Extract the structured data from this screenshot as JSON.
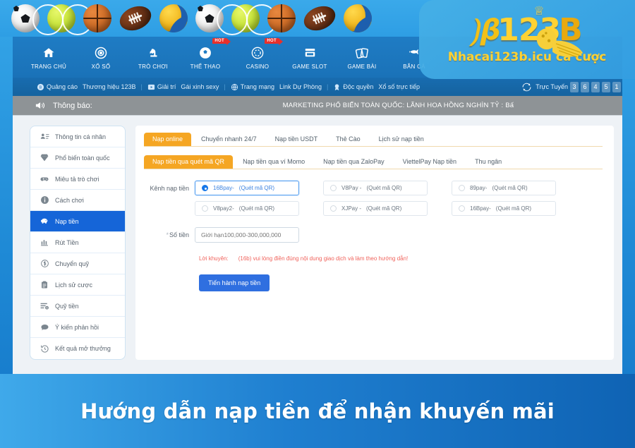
{
  "balls": [
    {
      "kind": "soccer",
      "icon": "soccer-ball-icon"
    },
    {
      "kind": "tennis",
      "icon": "tennis-ball-icon"
    },
    {
      "kind": "basket",
      "icon": "basketball-icon"
    },
    {
      "kind": "football",
      "icon": "american-football-icon"
    },
    {
      "kind": "volley",
      "icon": "volleyball-icon"
    },
    {
      "kind": "soccer",
      "icon": "soccer-ball-icon"
    },
    {
      "kind": "tennis",
      "icon": "tennis-ball-icon"
    },
    {
      "kind": "basket",
      "icon": "basketball-icon"
    },
    {
      "kind": "football",
      "icon": "american-football-icon"
    },
    {
      "kind": "volley",
      "icon": "volleyball-icon"
    }
  ],
  "logo": {
    "brand_mark": "123",
    "brand_mark_b": "B",
    "brand_sub": "Nhacai123b.icu cá cược",
    "color_gold": "#ffd233"
  },
  "mainnav": {
    "items": [
      {
        "label": "TRANG CHỦ",
        "icon": "home-icon",
        "hot": ""
      },
      {
        "label": "XỔ SỐ",
        "icon": "lottery-ball-icon",
        "hot": ""
      },
      {
        "label": "TRÒ CHƠI",
        "icon": "chess-knight-icon",
        "hot": ""
      },
      {
        "label": "THỂ THAO",
        "icon": "soccer-ball-icon",
        "hot": "HOT"
      },
      {
        "label": "CASINO",
        "icon": "casino-chip-icon",
        "hot": "HOT"
      },
      {
        "label": "GAME SLOT",
        "icon": "slot-machine-icon",
        "hot": ""
      },
      {
        "label": "GAME BÀI",
        "icon": "playing-cards-icon",
        "hot": ""
      },
      {
        "label": "BẮN CÁ",
        "icon": "fish-icon",
        "hot": ""
      }
    ]
  },
  "subnav": {
    "quang_cao": "Quảng cáo",
    "thuong_hieu": "Thương hiệu 123B",
    "giai_tri": "Giải trí",
    "gai_xinh": "Gái xinh sexy",
    "trang_mang": "Trang mạng",
    "link_du_phong": "Link Dự Phòng",
    "doc_quyen": "Độc quyền",
    "xo_so_truc_tiep": "Xổ số trực tiếp",
    "truc_tuyen": "Trực Tuyến",
    "online_digits": [
      "3",
      "6",
      "4",
      "5",
      "1"
    ],
    "sep": "|"
  },
  "announce": {
    "title": "Thông báo:",
    "marquee": "MARKETING PHỔ BIẾN TOÀN QUỐC:     LÃNH HOA HỒNG NGHÌN TỶ : Bấ"
  },
  "sidebar": {
    "items": [
      {
        "label": "Thông tin cá nhân",
        "icon": "user-card-icon",
        "active": false
      },
      {
        "label": "Phổ biến toàn quốc",
        "icon": "diamond-icon",
        "active": false
      },
      {
        "label": "Miêu tả trò chơi",
        "icon": "gamepad-icon",
        "active": false
      },
      {
        "label": "Cách chơi",
        "icon": "info-icon",
        "active": false
      },
      {
        "label": "Nạp tiền",
        "icon": "piggy-bank-icon",
        "active": true
      },
      {
        "label": "Rút Tiền",
        "icon": "withdraw-icon",
        "active": false
      },
      {
        "label": "Chuyển quỹ",
        "icon": "dollar-circle-icon",
        "active": false
      },
      {
        "label": "Lịch sử cược",
        "icon": "clipboard-icon",
        "active": false
      },
      {
        "label": "Quỹ tiền",
        "icon": "funds-list-icon",
        "active": false
      },
      {
        "label": "Ý kiến phản hồi",
        "icon": "chat-bubble-icon",
        "active": false
      },
      {
        "label": "Kết quả mở thưởng",
        "icon": "history-clock-icon",
        "active": false
      }
    ]
  },
  "panel": {
    "tabs_primary": [
      {
        "label": "Nạp online",
        "active": true
      },
      {
        "label": "Chuyển nhanh 24/7",
        "active": false
      },
      {
        "label": "Nạp tiền USDT",
        "active": false
      },
      {
        "label": "Thẻ Cào",
        "active": false
      },
      {
        "label": "Lịch sử nạp tiền",
        "active": false
      }
    ],
    "tabs_secondary": [
      {
        "label": "Nạp tiền qua quét mã QR",
        "active": true
      },
      {
        "label": "Nạp tiền qua ví Momo",
        "active": false
      },
      {
        "label": "Nạp tiền qua ZaloPay",
        "active": false
      },
      {
        "label": "ViettelPay Nạp tiền",
        "active": false
      },
      {
        "label": "Thu ngân",
        "active": false
      }
    ],
    "channel_label": "Kênh nạp tiền",
    "channels": [
      {
        "name": "16Bpay-",
        "note": "(Quét mã QR)",
        "selected": true
      },
      {
        "name": "V8Pay -",
        "note": "(Quét mã QR)",
        "selected": false
      },
      {
        "name": "89pay-",
        "note": "(Quét mã QR)",
        "selected": false
      },
      {
        "name": "V8pay2-",
        "note": "(Quét mã QR)",
        "selected": false
      },
      {
        "name": "XJPay -",
        "note": "(Quét mã QR)",
        "selected": false
      },
      {
        "name": "16Bpay-",
        "note": "(Quét mã QR)",
        "selected": false
      }
    ],
    "amount_label": "Số tiền",
    "amount_required_mark": "*",
    "amount_value": "",
    "amount_placeholder": "Giới hạn100,000-300,000,000",
    "advice_key": "Lời khuyên:",
    "advice_text": "(16b) vui lòng điền đúng nội dung giao dịch và làm theo hướng dẫn!",
    "submit_label": "Tiến hành nạp tiền"
  },
  "caption": {
    "text": "Hướng dẫn nạp tiền để nhận khuyến mãi"
  }
}
